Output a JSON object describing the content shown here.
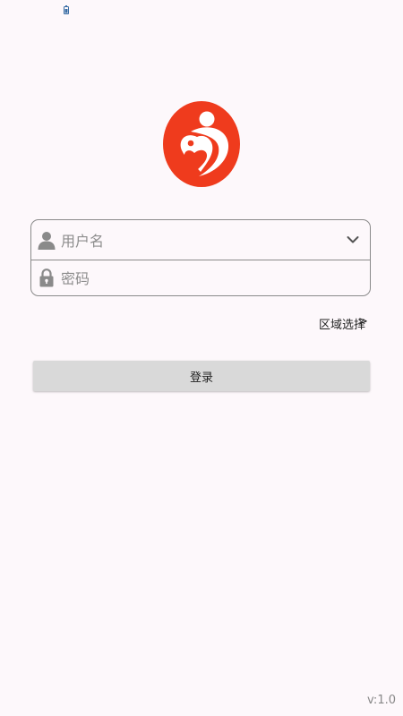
{
  "status_bar": {
    "icons": [
      "battery-icon"
    ]
  },
  "logo": {
    "icon": "mother-child-heart-logo",
    "color": "#ef3b1d"
  },
  "login_form": {
    "username_placeholder": "用户名",
    "username_value": "",
    "password_placeholder": "密码",
    "password_value": "",
    "icons": [
      "user-icon",
      "lock-icon",
      "chevron-down-icon"
    ]
  },
  "region": {
    "label": "区域选择",
    "arrow": ">"
  },
  "login_button": {
    "label": "登录"
  },
  "footer": {
    "version": "v:1.0"
  },
  "colors": {
    "background": "#fdf8fb",
    "brand": "#ef3b1d",
    "button": "#d9d9d9",
    "border": "#8a8a8a"
  }
}
